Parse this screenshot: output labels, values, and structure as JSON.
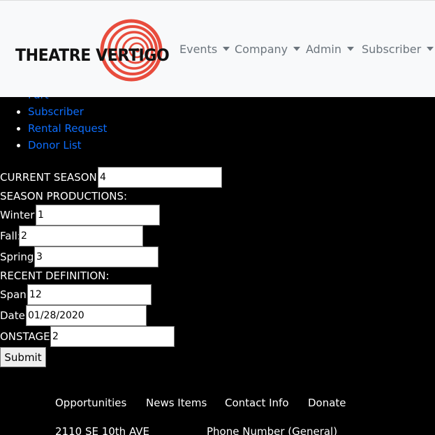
{
  "brand": {
    "logo_text": "THEATRE VERTIGO",
    "logo_colors": {
      "spiral": "#e84c3d",
      "text": "#111111"
    }
  },
  "nav": {
    "items": [
      {
        "label": "Events"
      },
      {
        "label": "Company"
      },
      {
        "label": "Admin"
      },
      {
        "label": "Subscriber"
      }
    ]
  },
  "links": [
    {
      "label": "Part"
    },
    {
      "label": "Subscriber"
    },
    {
      "label": "Rental Request"
    },
    {
      "label": "Donor List"
    }
  ],
  "form": {
    "current_season": {
      "label": "CURRENT SEASON:",
      "value": "4"
    },
    "season_productions_heading": "SEASON PRODUCTIONS:",
    "winter": {
      "label": "Winter:",
      "value": "1"
    },
    "fall": {
      "label": "Fall:",
      "value": "2"
    },
    "spring": {
      "label": "Spring:",
      "value": "3"
    },
    "recent_definition_heading": "RECENT DEFINITION:",
    "span": {
      "label": "Span:",
      "value": "12"
    },
    "date": {
      "label": "Date:",
      "value": "01/28/2020"
    },
    "onstage": {
      "label": "ONSTAGE:",
      "value": "2"
    },
    "submit_label": "Submit"
  },
  "footer": {
    "links": [
      {
        "label": "Opportunities"
      },
      {
        "label": "News Items"
      },
      {
        "label": "Contact Info"
      },
      {
        "label": "Donate"
      }
    ],
    "address": "2110 SE 10th AVE",
    "phone_label": "Phone Number (General)"
  },
  "colors": {
    "page_background": "#000000",
    "header_background": "#f8f9fa",
    "nav_text": "#6c757d",
    "link": "#0d6efd"
  }
}
